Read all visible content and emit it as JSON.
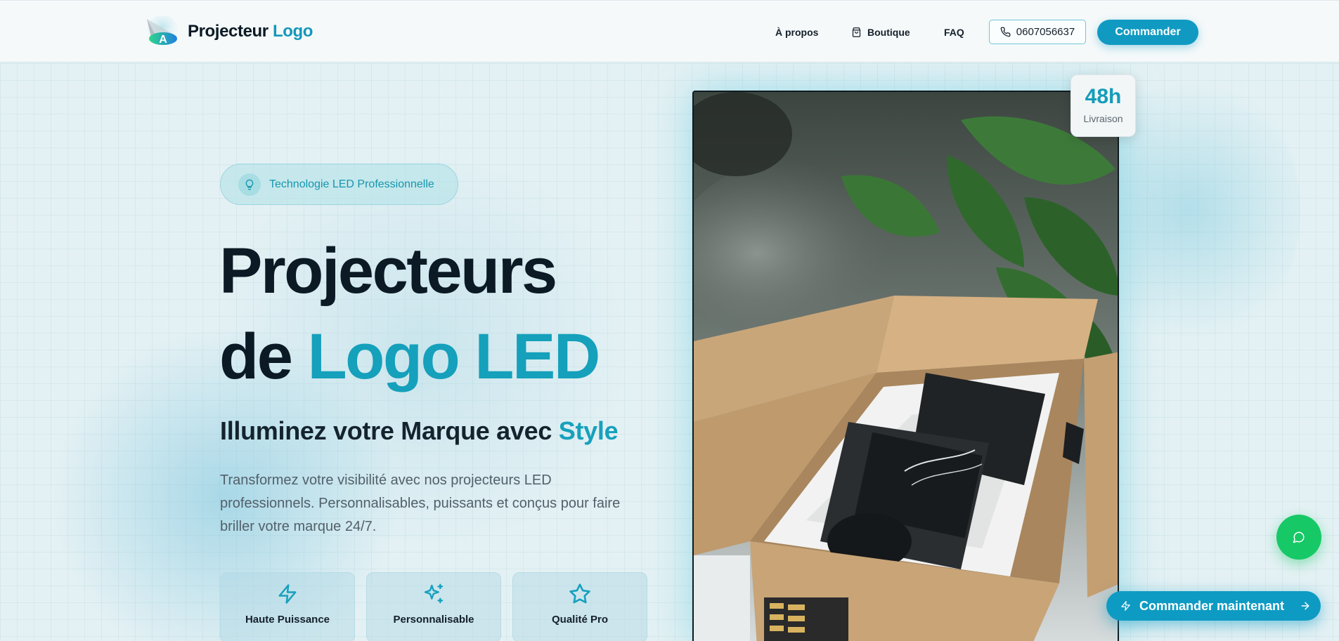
{
  "header": {
    "brand": {
      "name": "Projecteur",
      "accent": "Logo"
    },
    "nav": {
      "about": "À propos",
      "shop": "Boutique",
      "faq": "FAQ",
      "phone": "0607056637",
      "order": "Commander"
    }
  },
  "hero": {
    "badge": "Technologie LED Professionnelle",
    "title_line1": "Projecteurs",
    "title_line2_prefix": "de",
    "title_line2_accent": "Logo LED",
    "subtitle_prefix": "Illuminez votre Marque avec",
    "subtitle_accent": "Style",
    "description": "Transformez votre visibilité avec nos projecteurs LED professionnels. Personnalisables, puissants et conçus pour faire briller votre marque 24/7.",
    "features": [
      {
        "label": "Haute Puissance",
        "icon": "lightning-icon"
      },
      {
        "label": "Personnalisable",
        "icon": "sparkles-icon"
      },
      {
        "label": "Qualité Pro",
        "icon": "star-icon"
      }
    ]
  },
  "delivery": {
    "value": "48h",
    "label": "Livraison"
  },
  "cta": {
    "order_now": "Commander maintenant"
  },
  "colors": {
    "accent": "#15a0bb",
    "button": "#109ac2",
    "chat": "#17c867",
    "text": "#0b1a24"
  }
}
